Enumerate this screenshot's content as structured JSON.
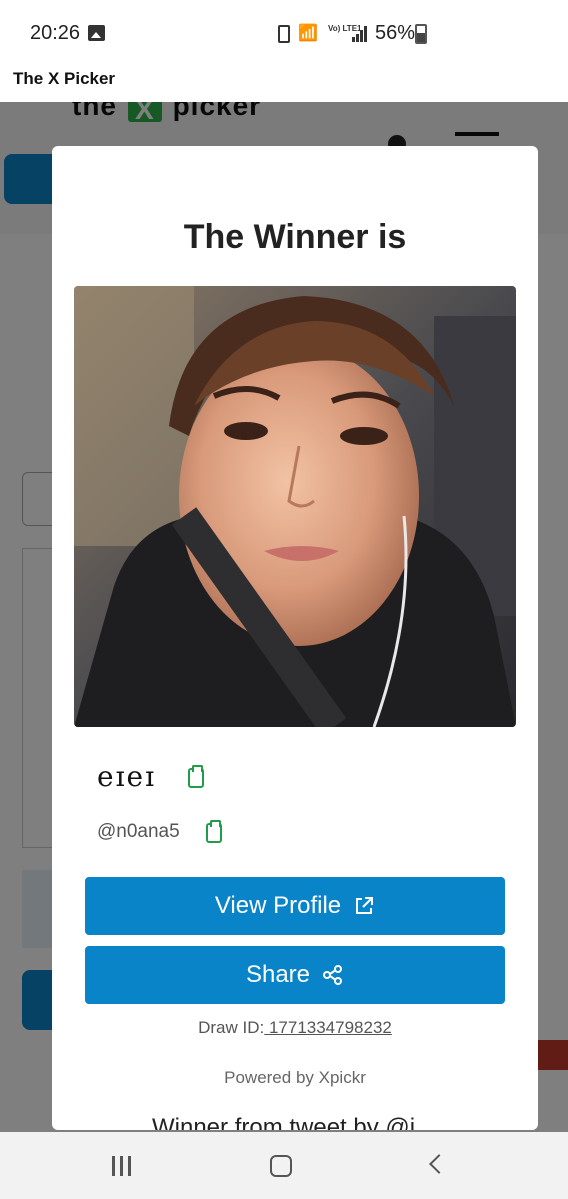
{
  "status_bar": {
    "time": "20:26",
    "battery_percent": "56%",
    "network_label": "Vo) LTE1",
    "icons": [
      "gallery-icon",
      "battery-saver-icon",
      "wifi-icon",
      "signal-icon",
      "battery-icon"
    ]
  },
  "app": {
    "title": "The X Picker"
  },
  "background_page": {
    "logo_left": "the",
    "logo_x": "X",
    "logo_right": "picker"
  },
  "modal": {
    "title": "The Winner is",
    "winner": {
      "display_name": "eɪeɪ",
      "handle": "@n0ana5"
    },
    "buttons": {
      "view_profile": "View Profile",
      "share": "Share"
    },
    "draw_id_label": "Draw ID:",
    "draw_id_value": " 1771334798232",
    "powered_by": "Powered by Xpickr",
    "winner_from_partial": "Winner from tweet by @i"
  },
  "colors": {
    "primary_button": "#0a84c9",
    "copy_icon": "#1f9d4a",
    "logo_green": "#2db34a"
  }
}
